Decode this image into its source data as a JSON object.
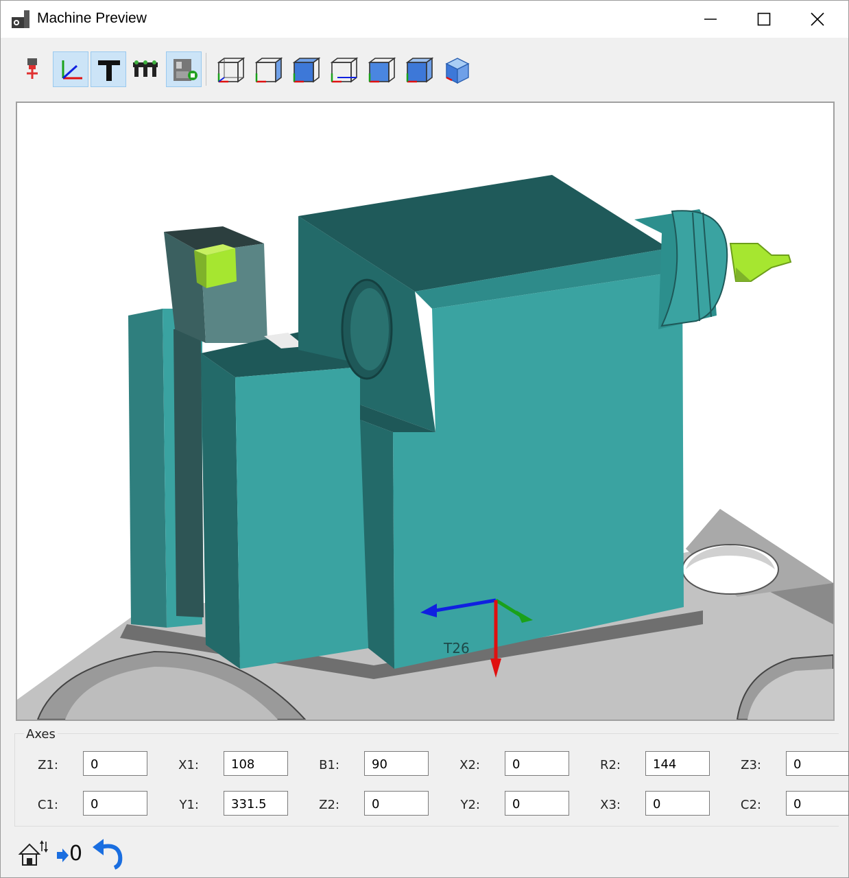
{
  "window": {
    "title": "Machine Preview",
    "icon": "machine-app-icon"
  },
  "toolbar": {
    "buttons": [
      {
        "name": "tool-pin-icon",
        "active": false
      },
      {
        "name": "axes-icon",
        "active": true
      },
      {
        "name": "text-t-icon",
        "active": true
      },
      {
        "name": "tool-holders-icon",
        "active": false
      },
      {
        "name": "machine-panel-icon",
        "active": true
      },
      {
        "name": "view-front-icon",
        "active": false
      },
      {
        "name": "view-back-icon",
        "active": false
      },
      {
        "name": "view-left-icon",
        "active": false
      },
      {
        "name": "view-right-icon",
        "active": false
      },
      {
        "name": "view-top-icon",
        "active": false
      },
      {
        "name": "view-bottom-icon",
        "active": false
      },
      {
        "name": "view-iso-icon",
        "active": false
      }
    ]
  },
  "viewport": {
    "tool_label": "T26",
    "colors": {
      "teal": "#3aa3a1",
      "teal_dark": "#236a69",
      "teal_darker": "#1e5858",
      "yellow_green": "#a6e630",
      "gray": "#bcbcbc",
      "x_axis": "#e01010",
      "y_axis": "#1aa11a",
      "z_axis": "#1020e0"
    }
  },
  "axes": {
    "legend": "Axes",
    "fields": [
      {
        "label": "Z1:",
        "value": "0"
      },
      {
        "label": "X1:",
        "value": "108"
      },
      {
        "label": "B1:",
        "value": "90"
      },
      {
        "label": "X2:",
        "value": "0"
      },
      {
        "label": "R2:",
        "value": "144"
      },
      {
        "label": "Z3:",
        "value": "0"
      },
      {
        "label": "C1:",
        "value": "0"
      },
      {
        "label": "Y1:",
        "value": "331.5"
      },
      {
        "label": "Z2:",
        "value": "0"
      },
      {
        "label": "Y2:",
        "value": "0"
      },
      {
        "label": "X3:",
        "value": "0"
      },
      {
        "label": "C2:",
        "value": "0"
      }
    ]
  },
  "footer": {
    "home_icon": "home-updown-icon",
    "zero_label": "0",
    "undo_icon": "undo-icon"
  }
}
